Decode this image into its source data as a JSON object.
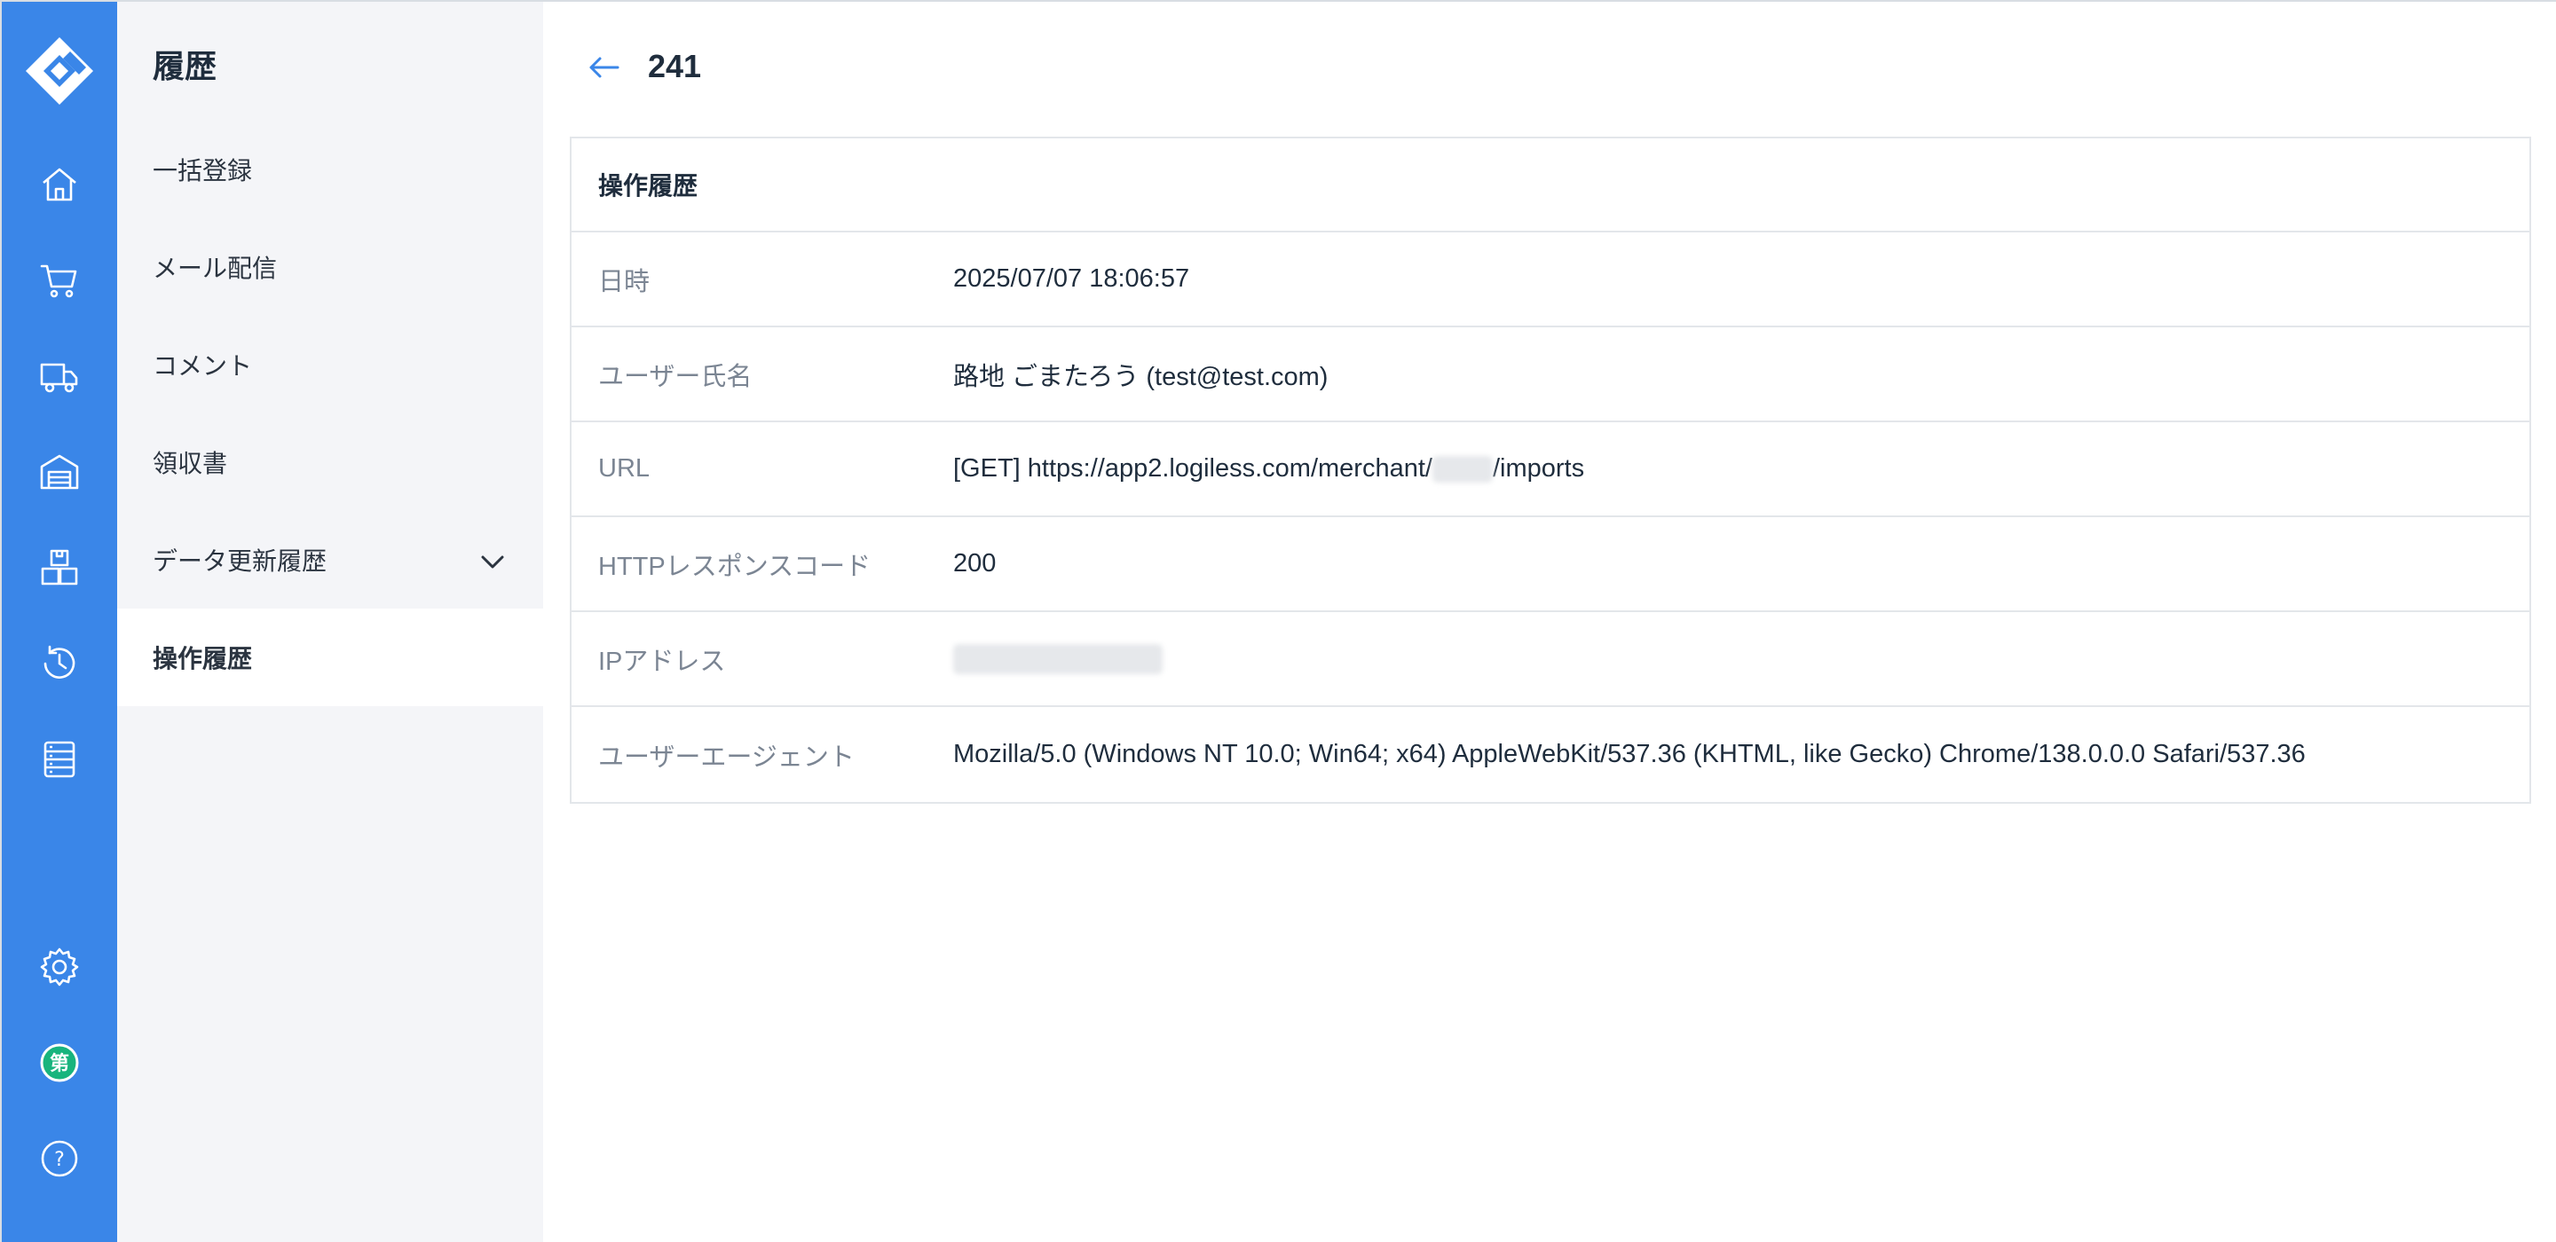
{
  "colors": {
    "rail_bg": "#3a86e8",
    "subnav_bg": "#f4f5f8",
    "badge_bg": "#18b47d",
    "label_text": "#7b8593"
  },
  "rail": {
    "logo": "app-logo",
    "items": [
      "home-icon",
      "cart-icon",
      "truck-icon",
      "warehouse-icon",
      "boxes-icon",
      "history-icon",
      "list-icon"
    ],
    "bottom": [
      "gear-icon",
      "user-badge",
      "help-icon"
    ],
    "badge_text": "第",
    "help_text": "?"
  },
  "subnav": {
    "title": "履歴",
    "items": [
      {
        "label": "一括登録"
      },
      {
        "label": "メール配信"
      },
      {
        "label": "コメント"
      },
      {
        "label": "領収書"
      },
      {
        "label": "データ更新履歴"
      },
      {
        "label": "操作履歴",
        "active": true
      }
    ]
  },
  "page": {
    "title": "241"
  },
  "panel": {
    "header": "操作履歴",
    "rows": [
      {
        "label": "日時",
        "value": "2025/07/07 18:06:57"
      },
      {
        "label": "ユーザー氏名",
        "value": "路地 ごまたろう (test@test.com)"
      },
      {
        "label": "URL",
        "value_prefix": "[GET] https://app2.logiless.com/merchant/",
        "value_suffix": "/imports"
      },
      {
        "label": "HTTPレスポンスコード",
        "value": "200"
      },
      {
        "label": "IPアドレス",
        "value": ""
      },
      {
        "label": "ユーザーエージェント",
        "value": "Mozilla/5.0 (Windows NT 10.0; Win64; x64) AppleWebKit/537.36 (KHTML, like Gecko) Chrome/138.0.0.0 Safari/537.36"
      }
    ]
  }
}
